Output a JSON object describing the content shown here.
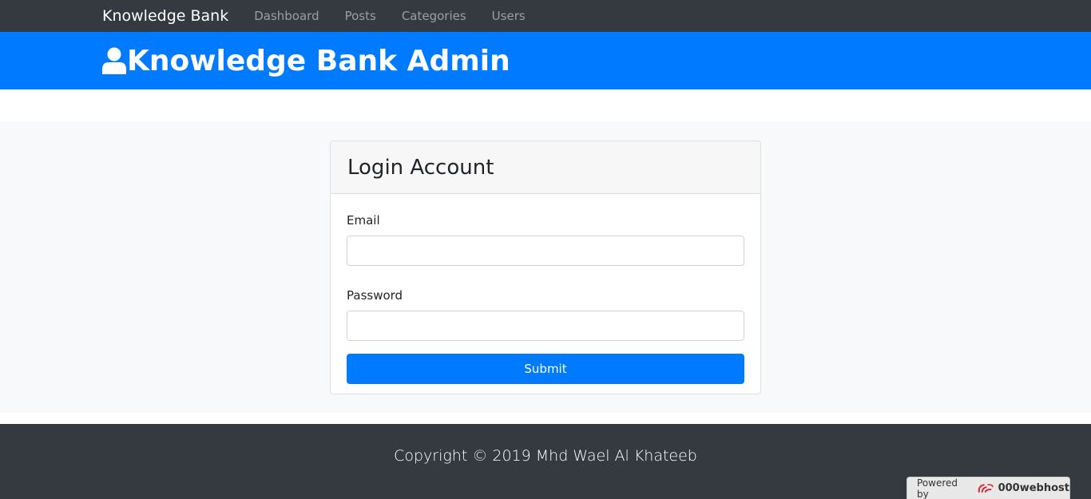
{
  "navbar": {
    "brand": "Knowledge Bank",
    "links": [
      "Dashboard",
      "Posts",
      "Categories",
      "Users"
    ]
  },
  "header": {
    "title": "Knowledge Bank Admin",
    "icon": "user-icon"
  },
  "login": {
    "title": "Login Account",
    "email_label": "Email",
    "email_value": "",
    "password_label": "Password",
    "password_value": "",
    "submit_label": "Submit"
  },
  "footer": {
    "copyright": "Copyright © 2019 Mhd Wael Al Khateeb"
  },
  "badge": {
    "prefix": "Powered by",
    "host": "000webhost",
    "icon": "000webhost-logo-icon"
  },
  "colors": {
    "navbar": "#343a40",
    "primary": "#007bff",
    "page_bg": "#f8f9fa"
  }
}
